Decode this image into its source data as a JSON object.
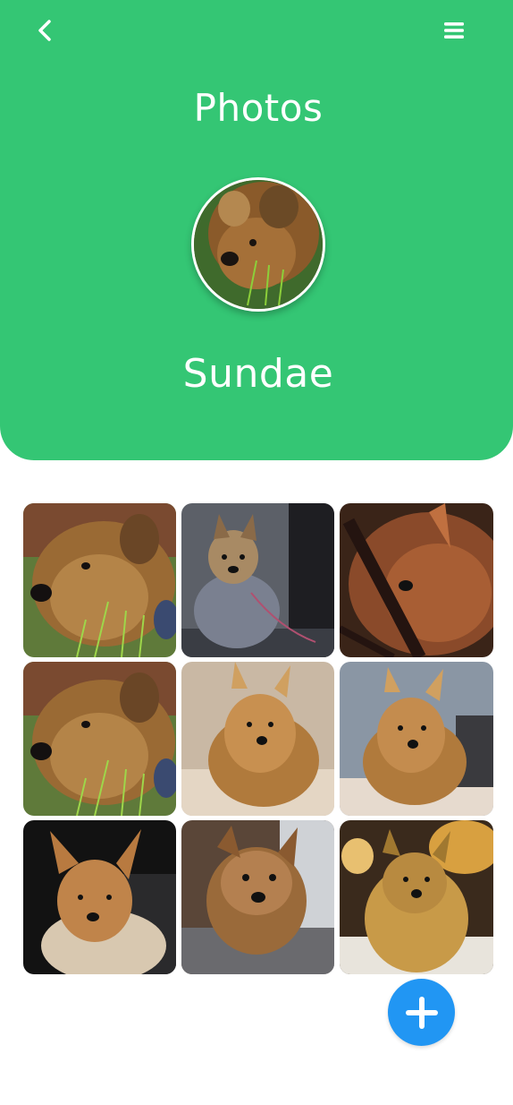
{
  "header": {
    "title": "Photos",
    "back_icon": "chevron-left-icon",
    "menu_icon": "hamburger-menu-icon",
    "background_color": "#34c674"
  },
  "profile": {
    "name": "Sundae",
    "avatar_icon": "dog-avatar"
  },
  "gallery": {
    "photos": [
      {
        "subject": "yorkie-in-grass"
      },
      {
        "subject": "yorkie-sitting-on-pavement"
      },
      {
        "subject": "yorkie-face-closeup"
      },
      {
        "subject": "yorkie-in-grass"
      },
      {
        "subject": "yorkie-on-carpet"
      },
      {
        "subject": "yorkie-on-carpet"
      },
      {
        "subject": "yorkie-ears-up"
      },
      {
        "subject": "yorkie-face-front"
      },
      {
        "subject": "yorkie-on-blanket"
      }
    ]
  },
  "fab": {
    "icon": "plus-icon",
    "color": "#2196f3"
  }
}
